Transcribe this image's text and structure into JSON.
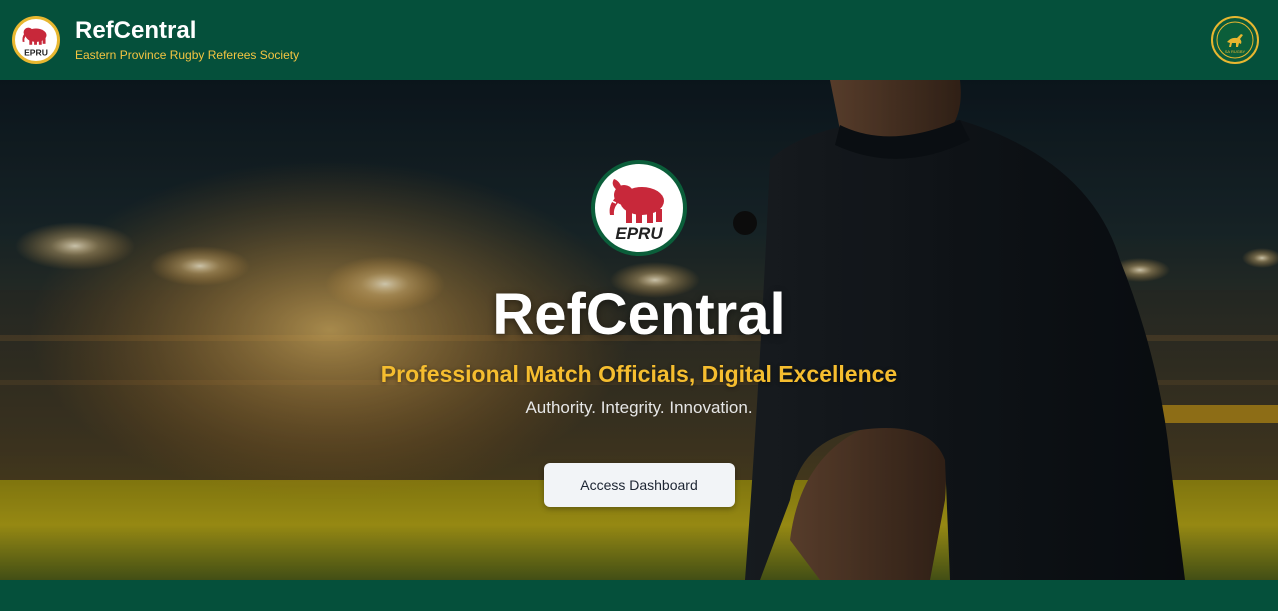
{
  "header": {
    "title": "RefCentral",
    "subtitle": "Eastern Province Rugby Referees Society",
    "logo_text": "EPRU",
    "badge_text": "SA RUGBY"
  },
  "hero": {
    "logo_text": "EPRU",
    "title": "RefCentral",
    "tagline": "Professional Match Officials, Digital Excellence",
    "motto": "Authority. Integrity. Innovation.",
    "cta_label": "Access Dashboard"
  },
  "colors": {
    "primary_green": "#05503b",
    "accent_gold": "#f5bd2f",
    "logo_red": "#c8283a"
  },
  "icons": {
    "brand_logo": "elephant-logo-icon",
    "badge": "springbok-badge-icon",
    "hero_logo": "elephant-logo-icon"
  }
}
